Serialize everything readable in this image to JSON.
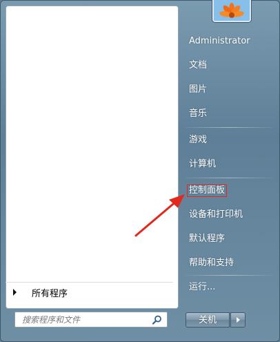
{
  "left_pane": {
    "all_programs_label": "所有程序",
    "search": {
      "placeholder": "搜索程序和文件",
      "value": ""
    }
  },
  "user": {
    "avatar_icon": "flower-avatar-icon"
  },
  "right_menu": {
    "items": [
      {
        "label": "Administrator"
      },
      {
        "label": "文档"
      },
      {
        "label": "图片"
      },
      {
        "label": "音乐"
      },
      {
        "label": "游戏"
      },
      {
        "label": "计算机"
      },
      {
        "label": "控制面板"
      },
      {
        "label": "设备和打印机"
      },
      {
        "label": "默认程序"
      },
      {
        "label": "帮助和支持"
      },
      {
        "label": "运行..."
      }
    ]
  },
  "shutdown": {
    "label": "关机"
  },
  "annotation": {
    "highlight_color": "#e3281d",
    "arrow_color": "#e3281d"
  }
}
